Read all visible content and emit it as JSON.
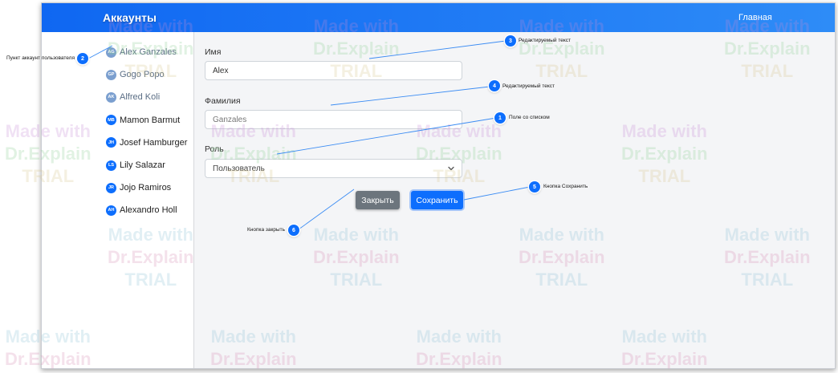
{
  "header": {
    "title": "Аккаунты",
    "home_link": "Главная"
  },
  "sidebar": {
    "users": [
      {
        "initials": "AG",
        "name": "Alex Ganzales",
        "dim": true
      },
      {
        "initials": "GP",
        "name": "Gogo Popo",
        "dim": true
      },
      {
        "initials": "AK",
        "name": "Alfred Koli",
        "dim": true
      },
      {
        "initials": "MB",
        "name": "Mamon Barmut",
        "dim": false
      },
      {
        "initials": "JH",
        "name": "Josef Hamburger",
        "dim": false
      },
      {
        "initials": "LS",
        "name": "Lily Salazar",
        "dim": false
      },
      {
        "initials": "JR",
        "name": "Jojo Ramiros",
        "dim": false
      },
      {
        "initials": "AH",
        "name": "Alexandro Holl",
        "dim": false
      }
    ]
  },
  "form": {
    "first_name_label": "Имя",
    "first_name_value": "Alex",
    "last_name_label": "Фамилия",
    "last_name_value": "Ganzales",
    "role_label": "Роль",
    "role_value": "Пользователь",
    "close_label": "Закрыть",
    "save_label": "Сохранить"
  },
  "callouts": [
    {
      "number": "1",
      "label": "Поле со списком"
    },
    {
      "number": "2",
      "label": "Пункт аккаунт пользователя"
    },
    {
      "number": "3",
      "label": "Редактируемый текст"
    },
    {
      "number": "4",
      "label": "Редактируемый текст"
    },
    {
      "number": "5",
      "label": "Кнопка Сохранить"
    },
    {
      "number": "6",
      "label": "Кнопка закрыть"
    }
  ],
  "watermark": {
    "line1": "Made with",
    "line2": "Dr.Explain",
    "line3": "TRIAL"
  },
  "colors": {
    "accent": "#0d6efd",
    "header_start": "#0f67f2",
    "header_end": "#2e8cf7",
    "close_button": "#6c757d"
  },
  "icons": {
    "role_dropdown": "chevron-down-icon",
    "user_avatar": "avatar-initials-icon"
  }
}
